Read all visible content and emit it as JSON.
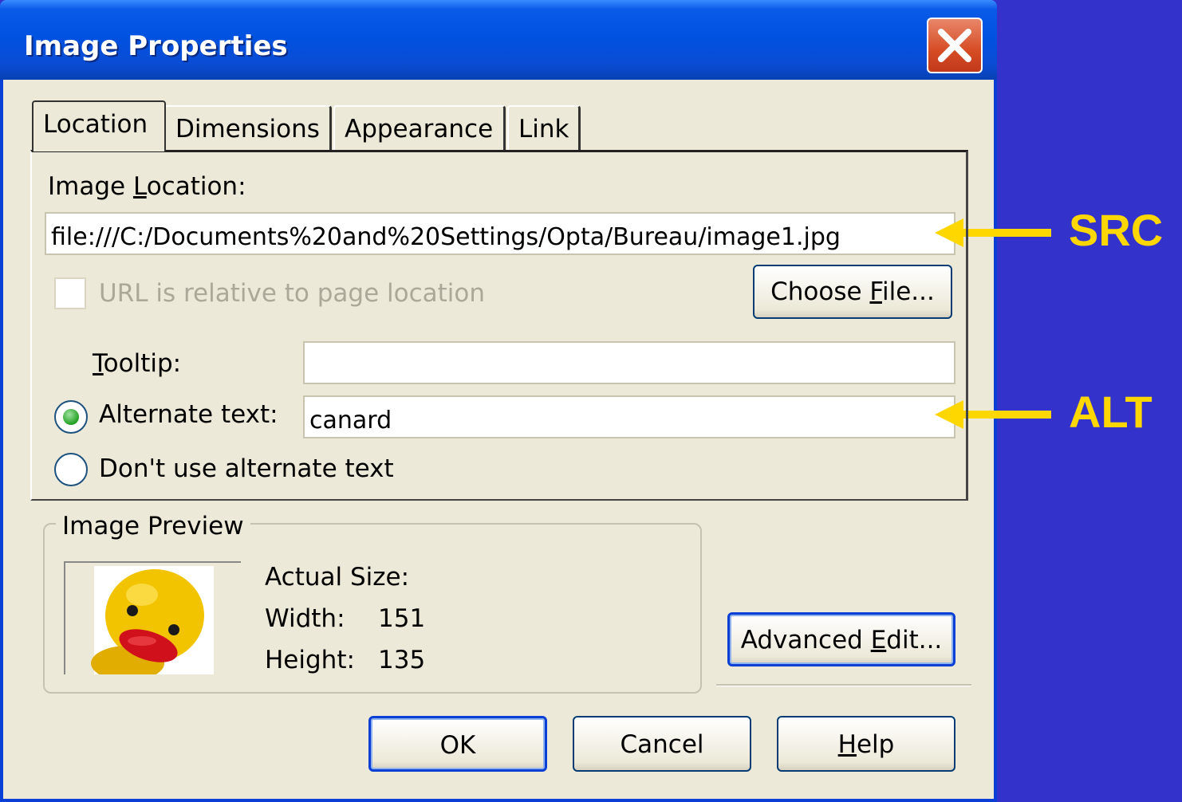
{
  "window": {
    "title": "Image Properties"
  },
  "tabs": [
    {
      "label": "Location",
      "active": true
    },
    {
      "label": "Dimensions",
      "active": false
    },
    {
      "label": "Appearance",
      "active": false
    },
    {
      "label": "Link",
      "active": false
    }
  ],
  "location": {
    "image_location_label_pre": "Image ",
    "image_location_label_ul": "L",
    "image_location_label_post": "ocation:",
    "image_location_value": "file:///C:/Documents%20and%20Settings/Opta/Bureau/image1.jpg",
    "relative_checkbox_label": "URL is relative to page location",
    "relative_checkbox_checked": false,
    "choose_file_pre": "Choose ",
    "choose_file_ul": "F",
    "choose_file_post": "ile...",
    "tooltip_label_ul": "T",
    "tooltip_label_post": "ooltip:",
    "tooltip_value": "",
    "alt_radio_label": "Alternate text:",
    "alt_radio_selected": true,
    "alt_value": "canard",
    "no_alt_radio_label": "Don't use alternate text",
    "no_alt_radio_selected": false
  },
  "preview": {
    "group_title": "Image Preview",
    "actual_size_label": "Actual Size:",
    "width_label": "Width:",
    "width_value": "151",
    "height_label": "Height:",
    "height_value": "135"
  },
  "advanced_edit": {
    "pre": "Advanced ",
    "ul": "E",
    "post": "dit..."
  },
  "buttons": {
    "ok": "OK",
    "cancel": "Cancel",
    "help_ul": "H",
    "help_post": "elp"
  },
  "annotations": {
    "src": "SRC",
    "alt": "ALT"
  },
  "colors": {
    "background": "#3333cc",
    "annotation": "#ffd700",
    "titlebar": "#0052e0",
    "dialog": "#ece9d8"
  }
}
